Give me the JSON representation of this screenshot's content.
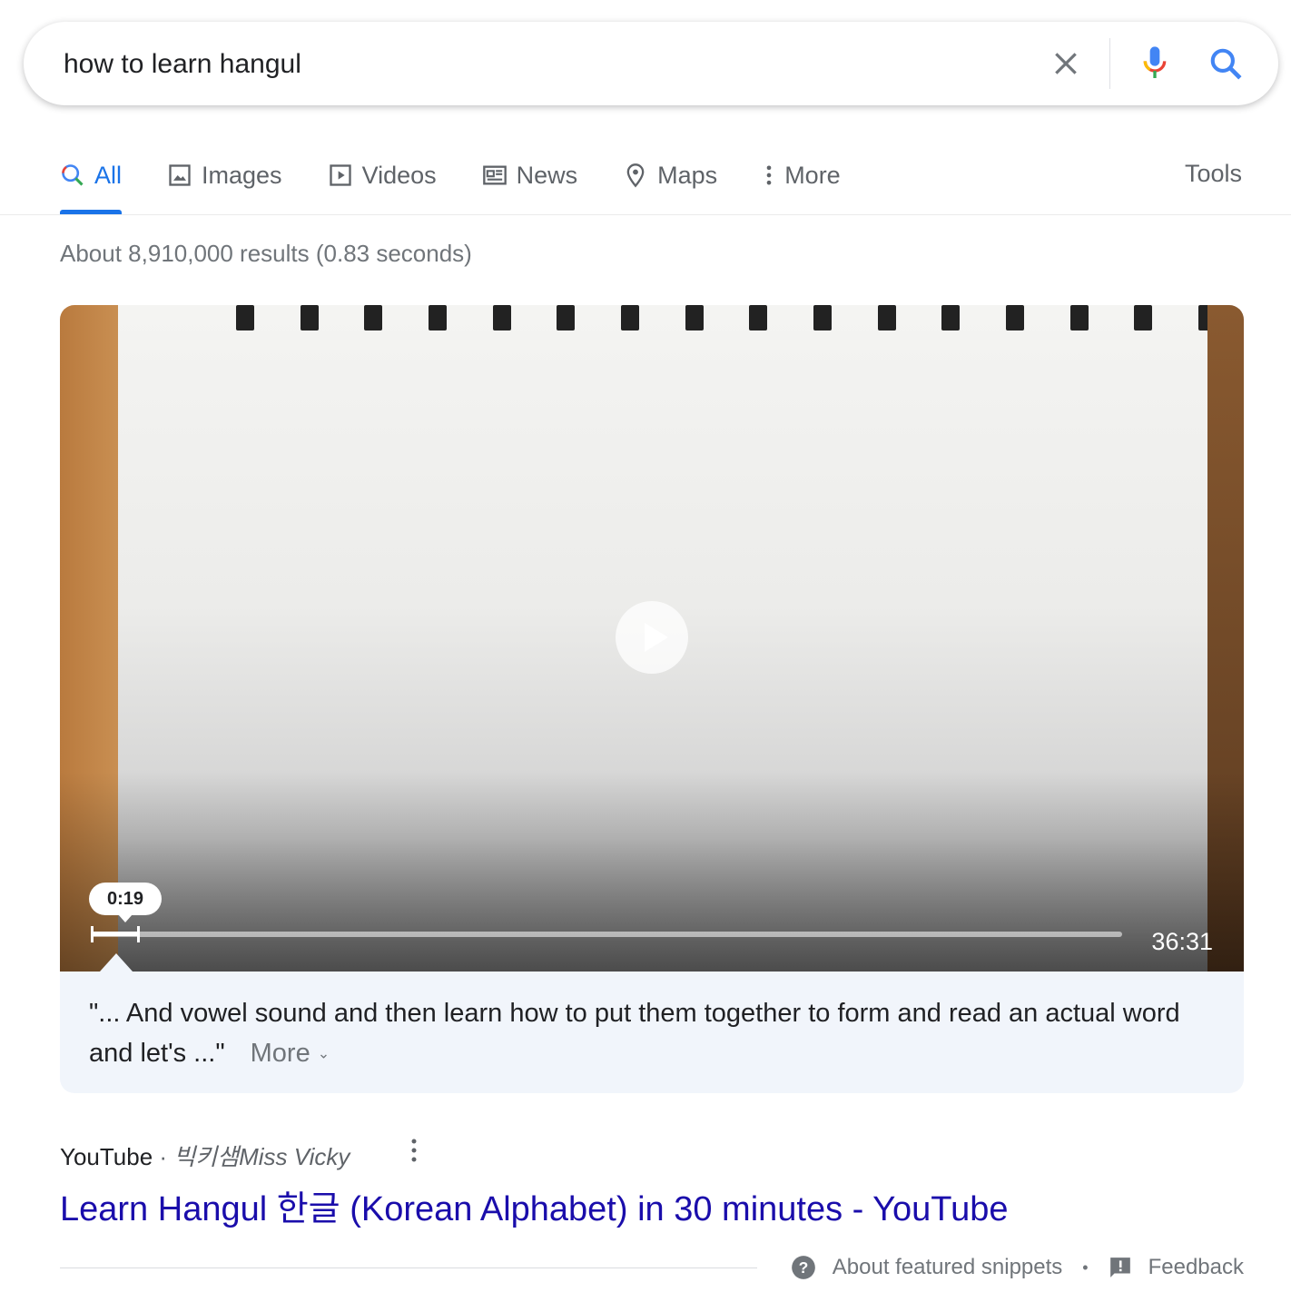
{
  "search": {
    "query": "how to learn hangul",
    "clear_icon": "close-icon",
    "voice_icon": "mic-icon",
    "search_icon": "search-icon"
  },
  "tabs": [
    {
      "label": "All",
      "icon": "search-icon",
      "active": true
    },
    {
      "label": "Images",
      "icon": "image-icon"
    },
    {
      "label": "Videos",
      "icon": "play-icon"
    },
    {
      "label": "News",
      "icon": "newspaper-icon"
    },
    {
      "label": "Maps",
      "icon": "map-pin-icon"
    },
    {
      "label": "More",
      "icon": "vertical-dots-icon"
    }
  ],
  "tools_label": "Tools",
  "result_stats": "About 8,910,000 results (0.83 seconds)",
  "video": {
    "timestamp": "0:19",
    "duration": "36:31",
    "progress_fraction": 0.0087
  },
  "snippet": {
    "text": "\"... And vowel sound and then learn how to put them together to form and read an actual word and let's ...\"",
    "more_label": "More"
  },
  "result": {
    "source": "YouTube",
    "separator": "·",
    "channel": "빅키샘Miss Vicky",
    "title": "Learn Hangul 한글 (Korean Alphabet) in 30 minutes - YouTube"
  },
  "footer": {
    "about_label": "About featured snippets",
    "dot": "•",
    "feedback_label": "Feedback"
  },
  "colors": {
    "accent": "#1a73e8",
    "link": "#1a0dab",
    "snippet_bg": "#f1f5fb"
  }
}
